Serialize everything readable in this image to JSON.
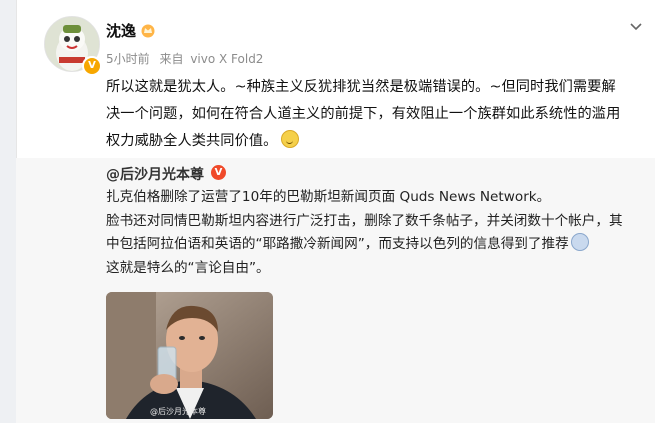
{
  "post": {
    "username": "沈逸",
    "timestamp": "5小时前",
    "source_prefix": "来自",
    "source": "vivo X Fold2",
    "text_lines": [
      "所以这就是犹太人。~种族主义反犹排犹当然是极端错误的。~但同时我们需要解",
      "决一个问题，如何在符合人道主义的前提下，有效阻止一个族群如此系统性的滥用",
      "权力威胁全人类共同价值。"
    ]
  },
  "repost": {
    "username": "@后沙月光本尊",
    "text_lines": [
      "扎克伯格删除了运营了10年的巴勒斯坦新闻页面 Quds News Network。",
      "脸书还对同情巴勒斯坦内容进行广泛打击，删除了数千条帖子，并关闭数十个帐户，其",
      "中包括阿拉伯语和英语的“耶路撒冷新闻网”，而支持以色列的信息得到了推荐",
      "这就是特么的“言论自由”。"
    ],
    "image_watermark": "@后沙月光本尊"
  },
  "icons": {
    "crown": "crown-icon",
    "chevron": "chevron-down-icon",
    "verified": "verified-badge-icon",
    "emoji_smile": "smile-emoji-icon",
    "emoji_scream": "scream-emoji-icon"
  },
  "colors": {
    "verified_orange": "#f7a700",
    "verified_red": "#f04a2a",
    "repost_bg": "#f7f7f7",
    "meta_gray": "#8c8c8c"
  }
}
